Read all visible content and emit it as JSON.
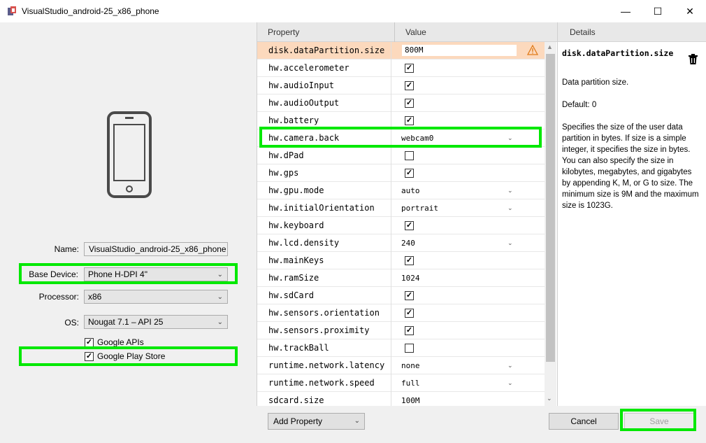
{
  "window": {
    "title": "VisualStudio_android-25_x86_phone",
    "minimize": "—",
    "maximize": "☐",
    "close": "✕"
  },
  "form": {
    "name_label": "Name:",
    "name_value": "VisualStudio_android-25_x86_phone",
    "base_device_label": "Base Device:",
    "base_device_value": "Phone H-DPI 4\"",
    "processor_label": "Processor:",
    "processor_value": "x86",
    "os_label": "OS:",
    "os_value": "Nougat 7.1 – API 25",
    "google_apis_label": "Google APIs",
    "google_apis_checked": true,
    "google_play_label": "Google Play Store",
    "google_play_checked": true
  },
  "table": {
    "header_property": "Property",
    "header_value": "Value",
    "rows": [
      {
        "name": "disk.dataPartition.size",
        "type": "text",
        "value": "800M",
        "selected": true,
        "warning": true
      },
      {
        "name": "hw.accelerometer",
        "type": "checkbox",
        "checked": true
      },
      {
        "name": "hw.audioInput",
        "type": "checkbox",
        "checked": true
      },
      {
        "name": "hw.audioOutput",
        "type": "checkbox",
        "checked": true
      },
      {
        "name": "hw.battery",
        "type": "checkbox",
        "checked": true
      },
      {
        "name": "hw.camera.back",
        "type": "dropdown",
        "value": "webcam0"
      },
      {
        "name": "hw.dPad",
        "type": "checkbox",
        "checked": false
      },
      {
        "name": "hw.gps",
        "type": "checkbox",
        "checked": true
      },
      {
        "name": "hw.gpu.mode",
        "type": "dropdown",
        "value": "auto"
      },
      {
        "name": "hw.initialOrientation",
        "type": "dropdown",
        "value": "portrait"
      },
      {
        "name": "hw.keyboard",
        "type": "checkbox",
        "checked": true
      },
      {
        "name": "hw.lcd.density",
        "type": "dropdown",
        "value": "240"
      },
      {
        "name": "hw.mainKeys",
        "type": "checkbox",
        "checked": true
      },
      {
        "name": "hw.ramSize",
        "type": "text",
        "value": "1024"
      },
      {
        "name": "hw.sdCard",
        "type": "checkbox",
        "checked": true
      },
      {
        "name": "hw.sensors.orientation",
        "type": "checkbox",
        "checked": true
      },
      {
        "name": "hw.sensors.proximity",
        "type": "checkbox",
        "checked": true
      },
      {
        "name": "hw.trackBall",
        "type": "checkbox",
        "checked": false
      },
      {
        "name": "runtime.network.latency",
        "type": "dropdown",
        "value": "none"
      },
      {
        "name": "runtime.network.speed",
        "type": "dropdown",
        "value": "full"
      },
      {
        "name": "sdcard.size",
        "type": "text",
        "value": "100M"
      }
    ]
  },
  "details": {
    "header": "Details",
    "title": "disk.dataPartition.size",
    "summary": "Data partition size.",
    "default": "Default: 0",
    "description": "Specifies the size of the user data partition in bytes. If size is a simple integer, it specifies the size in bytes. You can also specify the size in kilobytes, megabytes, and gigabytes by appending K, M, or G to size. The minimum size is 9M and the maximum size is 1023G."
  },
  "buttons": {
    "add_property": "Add Property",
    "cancel": "Cancel",
    "save": "Save"
  },
  "icons": {
    "app": "android-emulator-icon",
    "phone": "phone-icon",
    "warning": "warning-icon",
    "trash": "trash-icon"
  },
  "colors": {
    "highlight": "#00e800",
    "selected_row": "#fcd9bd",
    "warning": "#e07b1a"
  }
}
